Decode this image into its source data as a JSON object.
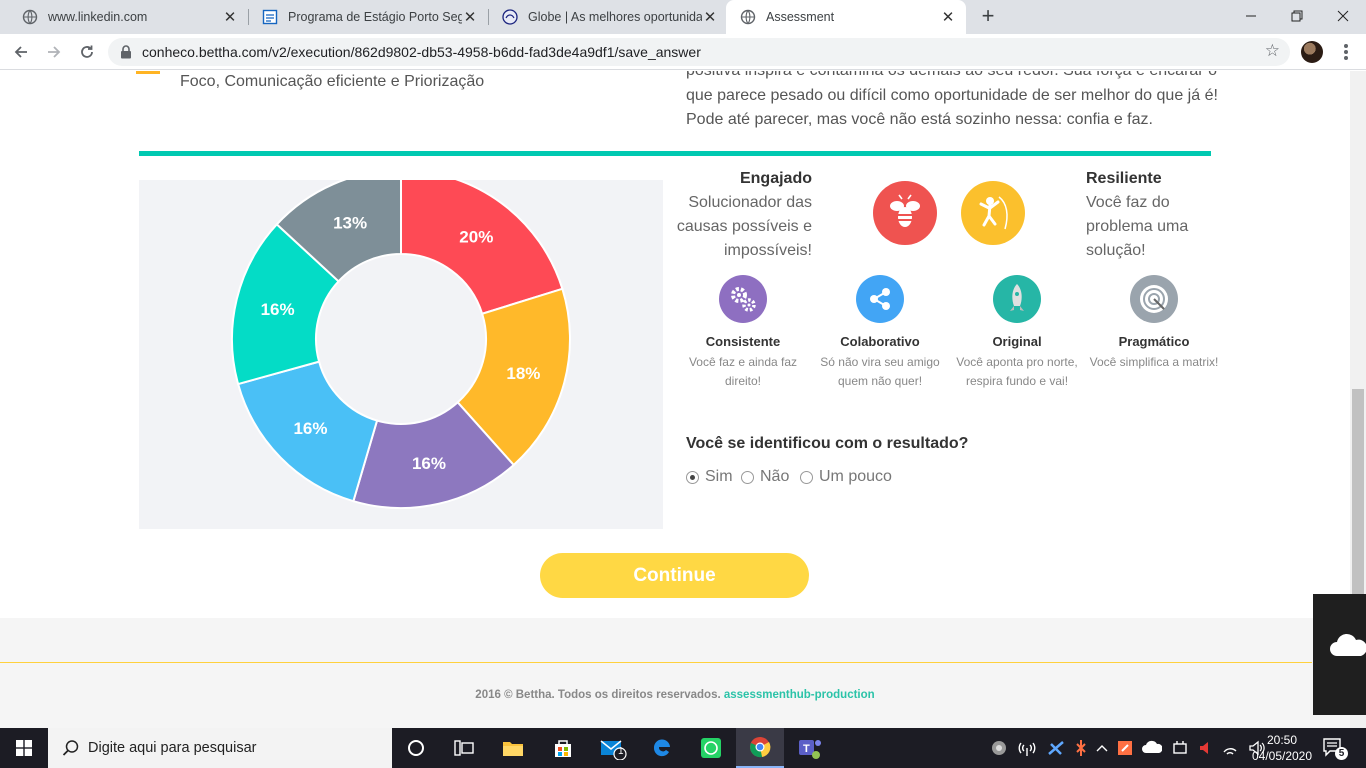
{
  "browser": {
    "tabs": [
      {
        "title": "www.linkedin.com",
        "favicon": "globe-icon",
        "active": false
      },
      {
        "title": "Programa de Estágio Porto Seguro",
        "favicon": "document-icon",
        "active": false
      },
      {
        "title": "Globe | As melhores oportunidades",
        "favicon": "globe-logo-icon",
        "active": false
      },
      {
        "title": "Assessment",
        "favicon": "globe-icon",
        "active": true
      }
    ],
    "url": "conheco.bettha.com/v2/execution/862d9802-db53-4958-b6dd-fad3de4a9df1/save_answer"
  },
  "page": {
    "previous_competencies": "Foco, Comunicação eficiente e Priorização",
    "previous_paragraph": "positiva inspira e contamina os demais ao seu redor. Sua força é encarar o que parece pesado ou difícil como oportunidade de ser melhor do que já é! Pode até parecer, mas você não está sozinho nessa: confia e faz.",
    "leads": [
      {
        "title": "Engajado",
        "description": "Solucionador das causas possíveis e impossíveis!",
        "icon": "bee-icon",
        "color": "#ef5350"
      },
      {
        "title": "Resiliente",
        "description": "Você faz do problema uma solução!",
        "icon": "climber-icon",
        "color": "#fbc02d"
      }
    ],
    "competencies": [
      {
        "title": "Consistente",
        "description": "Você faz e ainda faz direito!",
        "icon": "gears-icon",
        "color": "#8e6fc1"
      },
      {
        "title": "Colaborativo",
        "description": "Só não vira seu amigo quem não quer!",
        "icon": "share-icon",
        "color": "#42a5f5"
      },
      {
        "title": "Original",
        "description": "Você aponta pro norte, respira fundo e vai!",
        "icon": "rocket-icon",
        "color": "#26b6a6"
      },
      {
        "title": "Pragmático",
        "description": "Você simplifica a matrix!",
        "icon": "target-icon",
        "color": "#9aa4ad"
      }
    ],
    "question": "Você se identificou com o resultado?",
    "options": [
      {
        "label": "Sim",
        "checked": true
      },
      {
        "label": "Não",
        "checked": false
      },
      {
        "label": "Um pouco",
        "checked": false
      }
    ],
    "continue_label": "Continue",
    "footer": {
      "text": "2016 © Bettha. Todos os direitos reservados.",
      "link": "assessmenthub-production"
    }
  },
  "chart_data": {
    "type": "pie",
    "donut": true,
    "slices": [
      {
        "label": "20%",
        "value": 20,
        "color": "#fe4a55"
      },
      {
        "label": "18%",
        "value": 18,
        "color": "#ffb92a"
      },
      {
        "label": "16%",
        "value": 16,
        "color": "#8d78bf"
      },
      {
        "label": "16%",
        "value": 16,
        "color": "#4ac0f6"
      },
      {
        "label": "16%",
        "value": 16,
        "color": "#04dcc6"
      },
      {
        "label": "13%",
        "value": 13,
        "color": "#7e8f98"
      }
    ]
  },
  "taskbar": {
    "search_placeholder": "Digite aqui para pesquisar",
    "mail_badge": "1",
    "time": "20:50",
    "date": "04/05/2020",
    "notification_count": "5"
  }
}
